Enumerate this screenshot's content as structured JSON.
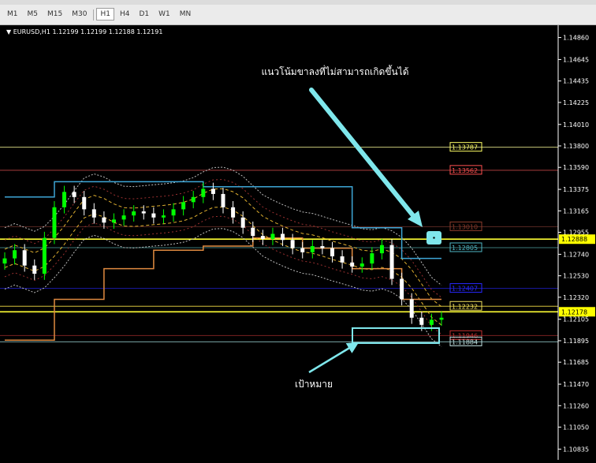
{
  "toolbar": {
    "timeframes": [
      {
        "label": "M1",
        "active": false
      },
      {
        "label": "M5",
        "active": false
      },
      {
        "label": "M15",
        "active": false
      },
      {
        "label": "M30",
        "active": false
      },
      {
        "label": "H1",
        "active": true
      },
      {
        "label": "H4",
        "active": false
      },
      {
        "label": "D1",
        "active": false
      },
      {
        "label": "W1",
        "active": false
      },
      {
        "label": "MN",
        "active": false
      }
    ]
  },
  "chart_header": {
    "symbol": "EURUSD,H1",
    "ohlc": "1.12199 1.12199 1.12188 1.12191"
  },
  "colors": {
    "background": "#000000",
    "bull_candle": "#00ff00",
    "bear_candle": "#ffffff",
    "annotation": "#7fe7ec",
    "price_marker": "#ffff00"
  },
  "annotations": {
    "trend_text": "แนวโน้มขาลงที่ไม่สามารถเกิดขึ้นได้",
    "target_text": "เป้าหมาย"
  },
  "chart_data": {
    "type": "line",
    "symbol": "EURUSD",
    "timeframe": "H1",
    "ylim": [
      1.1073,
      1.1498
    ],
    "y_ticks": [
      "1.14860",
      "1.14645",
      "1.14435",
      "1.14225",
      "1.14010",
      "1.13800",
      "1.13590",
      "1.13375",
      "1.13165",
      "1.12955",
      "1.12740",
      "1.12530",
      "1.12320",
      "1.12105",
      "1.11895",
      "1.11685",
      "1.11470",
      "1.11260",
      "1.11050",
      "1.10835"
    ],
    "current_price": "1.12178",
    "marker_price": "1.12888",
    "horizontal_levels": [
      {
        "label": "1.13787",
        "value": 1.13787,
        "color": "#c8c878",
        "box": "#ffff66"
      },
      {
        "label": "1.13562",
        "value": 1.13562,
        "color": "#a83c3c",
        "box": "#ff5050"
      },
      {
        "label": "1.13010",
        "value": 1.1301,
        "color": "#5a2a22",
        "box": "#8b3b2b"
      },
      {
        "label": "1.12888",
        "value": 1.12888,
        "color": "#ffff33",
        "box": null
      },
      {
        "label": "1.12805",
        "value": 1.12805,
        "color": "#3c7878",
        "box": "#4fb6c4"
      },
      {
        "label": "1.12407",
        "value": 1.12407,
        "color": "#1a1aa8",
        "box": "#2828ff"
      },
      {
        "label": "1.12232",
        "value": 1.12232,
        "color": "#d4c23c",
        "box": "#f0e060"
      },
      {
        "label": "1.12178",
        "value": 1.12178,
        "color": "#ffff33",
        "box": null
      },
      {
        "label": "1.11946",
        "value": 1.11946,
        "color": "#7a2020",
        "box": "#c03030"
      },
      {
        "label": "1.11884",
        "value": 1.11884,
        "color": "#7aa6a6",
        "box": "#bfe0e0"
      }
    ],
    "close_series": [
      1.127,
      1.1278,
      1.1263,
      1.1255,
      1.129,
      1.132,
      1.1335,
      1.133,
      1.1318,
      1.131,
      1.1305,
      1.1308,
      1.1312,
      1.1316,
      1.1314,
      1.131,
      1.1312,
      1.1318,
      1.1325,
      1.133,
      1.1338,
      1.1333,
      1.132,
      1.131,
      1.13,
      1.1292,
      1.1289,
      1.1294,
      1.1288,
      1.128,
      1.1276,
      1.1282,
      1.128,
      1.1272,
      1.1266,
      1.1262,
      1.1265,
      1.1275,
      1.1283,
      1.125,
      1.123,
      1.1212,
      1.1205,
      1.121,
      1.1212
    ]
  }
}
